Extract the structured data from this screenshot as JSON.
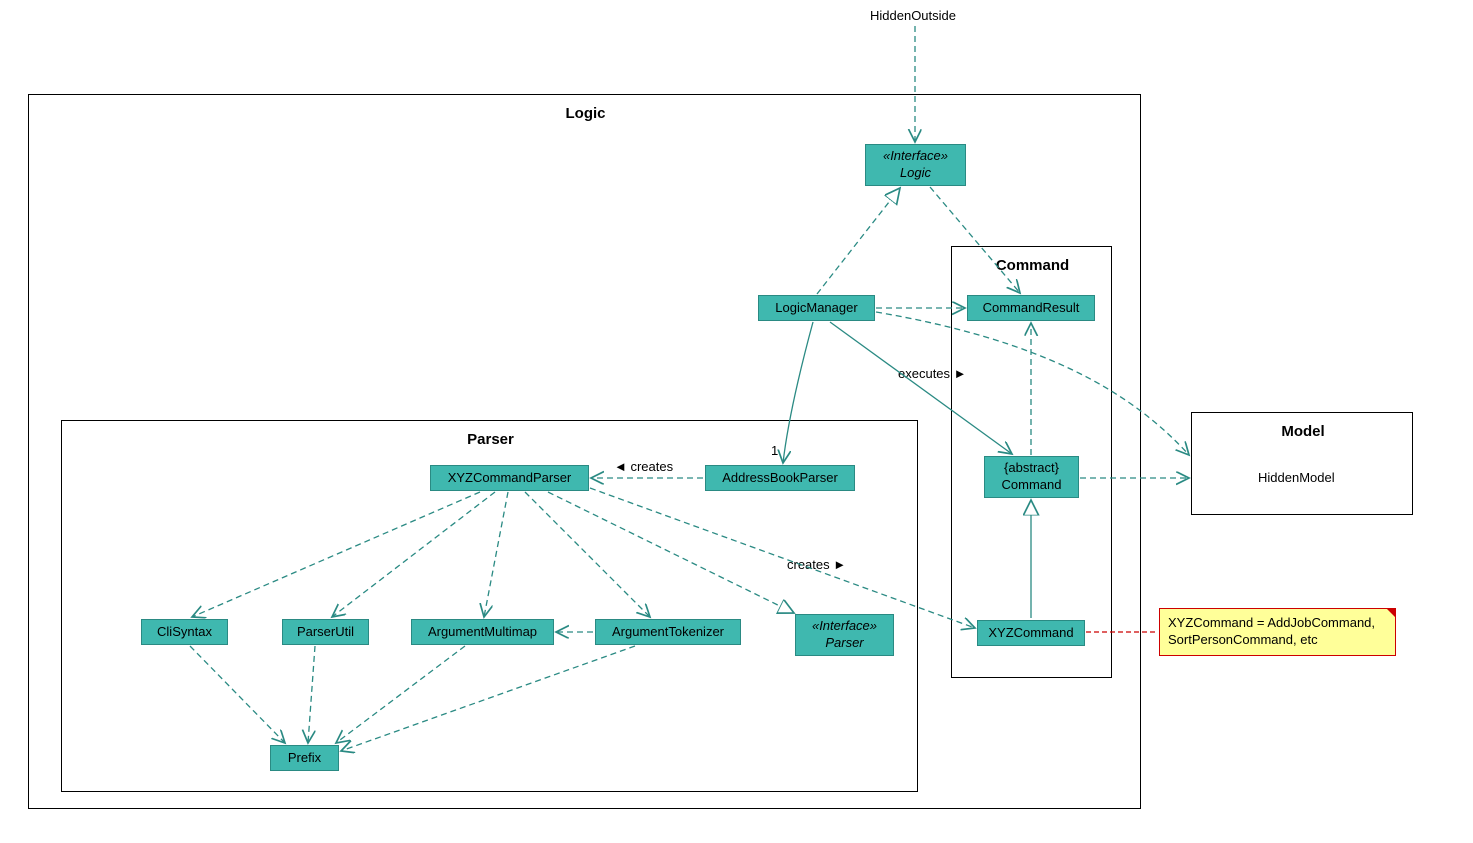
{
  "external": {
    "hiddenOutside": "HiddenOutside"
  },
  "packages": {
    "logic": "Logic",
    "parser": "Parser",
    "command": "Command",
    "model": "Model"
  },
  "nodes": {
    "logicInterface": {
      "stereotype": "«Interface»",
      "name": "Logic"
    },
    "logicManager": "LogicManager",
    "commandResult": "CommandResult",
    "abstractCommand": {
      "stereotype": "{abstract}",
      "name": "Command"
    },
    "xyzCommand": "XYZCommand",
    "addressBookParser": "AddressBookParser",
    "xyzCommandParser": "XYZCommandParser",
    "cliSyntax": "CliSyntax",
    "parserUtil": "ParserUtil",
    "argumentMultimap": "ArgumentMultimap",
    "argumentTokenizer": "ArgumentTokenizer",
    "parserInterface": {
      "stereotype": "«Interface»",
      "name": "Parser"
    },
    "prefix": "Prefix",
    "hiddenModel": "HiddenModel"
  },
  "edgeLabels": {
    "creates1": "◄ creates",
    "creates2": "creates ►",
    "executes": "executes ►",
    "one": "1"
  },
  "note": {
    "line1": "XYZCommand = AddJobCommand,",
    "line2": "SortPersonCommand, etc"
  }
}
